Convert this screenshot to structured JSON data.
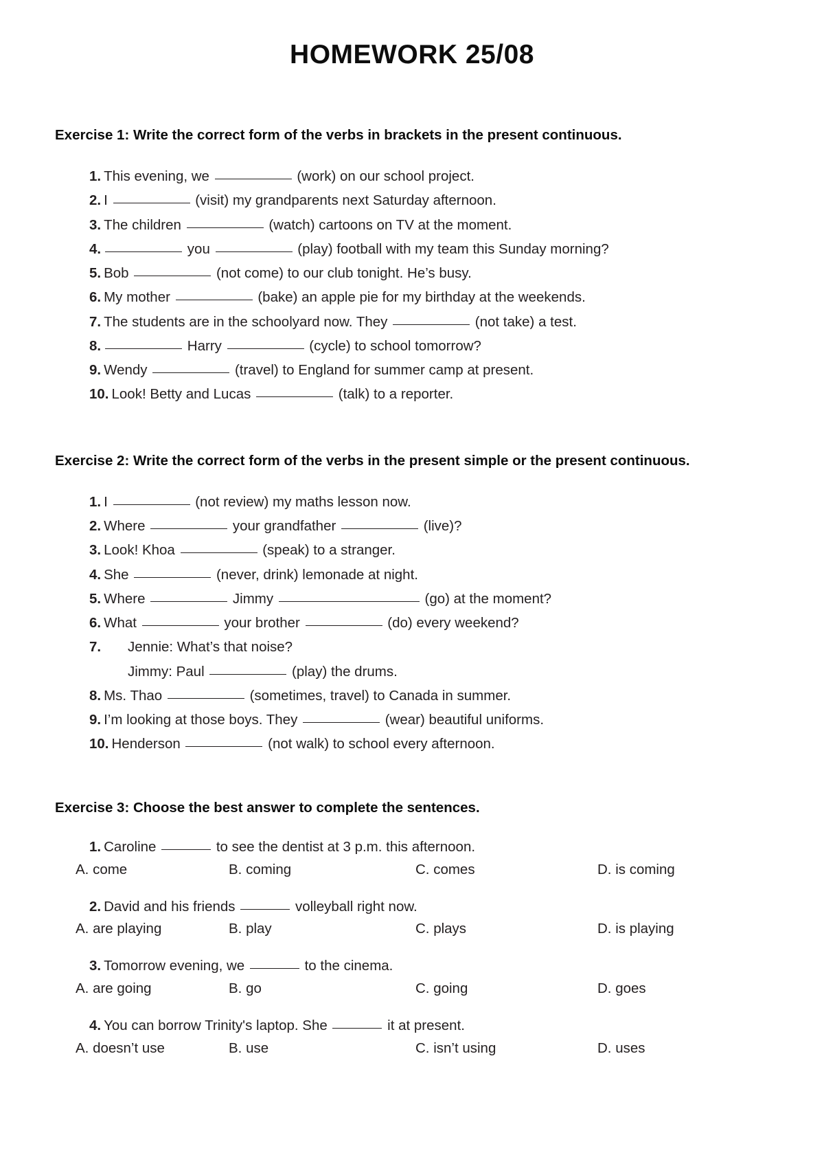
{
  "document": {
    "title": "HOMEWORK 25/08"
  },
  "exercise1": {
    "heading": "Exercise 1: Write the correct form of the verbs in brackets in the present continuous.",
    "items": [
      {
        "num": "1.",
        "parts": [
          {
            "t": "text",
            "v": "This evening, we "
          },
          {
            "t": "blank",
            "v": "md"
          },
          {
            "t": "text",
            "v": " (work) on our school project."
          }
        ]
      },
      {
        "num": "2.",
        "parts": [
          {
            "t": "text",
            "v": "I "
          },
          {
            "t": "blank",
            "v": "md"
          },
          {
            "t": "text",
            "v": " (visit) my grandparents next Saturday afternoon."
          }
        ]
      },
      {
        "num": "3.",
        "parts": [
          {
            "t": "text",
            "v": "The children "
          },
          {
            "t": "blank",
            "v": "md"
          },
          {
            "t": "text",
            "v": " (watch) cartoons on TV at the moment."
          }
        ]
      },
      {
        "num": "4.",
        "parts": [
          {
            "t": "blank",
            "v": "md"
          },
          {
            "t": "text",
            "v": " you "
          },
          {
            "t": "blank",
            "v": "md"
          },
          {
            "t": "text",
            "v": " (play) football with my team this Sunday morning?"
          }
        ]
      },
      {
        "num": "5.",
        "parts": [
          {
            "t": "text",
            "v": "Bob "
          },
          {
            "t": "blank",
            "v": "md"
          },
          {
            "t": "text",
            "v": " (not come) to our club tonight. He’s busy."
          }
        ]
      },
      {
        "num": "6.",
        "parts": [
          {
            "t": "text",
            "v": "My mother "
          },
          {
            "t": "blank",
            "v": "md"
          },
          {
            "t": "text",
            "v": " (bake) an apple pie for my birthday at the weekends."
          }
        ]
      },
      {
        "num": "7.",
        "parts": [
          {
            "t": "text",
            "v": "The students are in the schoolyard now. They "
          },
          {
            "t": "blank",
            "v": "md"
          },
          {
            "t": "text",
            "v": " (not take) a test."
          }
        ]
      },
      {
        "num": "8.",
        "parts": [
          {
            "t": "blank",
            "v": "md"
          },
          {
            "t": "text",
            "v": " Harry "
          },
          {
            "t": "blank",
            "v": "md"
          },
          {
            "t": "text",
            "v": " (cycle) to school tomorrow?"
          }
        ]
      },
      {
        "num": "9.",
        "parts": [
          {
            "t": "text",
            "v": "Wendy "
          },
          {
            "t": "blank",
            "v": "md"
          },
          {
            "t": "text",
            "v": " (travel) to England for summer camp at present."
          }
        ]
      },
      {
        "num": "10.",
        "parts": [
          {
            "t": "text",
            "v": "Look! Betty and Lucas "
          },
          {
            "t": "blank",
            "v": "md"
          },
          {
            "t": "text",
            "v": " (talk) to a reporter."
          }
        ]
      }
    ]
  },
  "exercise2": {
    "heading": "Exercise 2: Write the correct form of the verbs in the present simple or the present continuous.",
    "items": [
      {
        "num": "1.",
        "parts": [
          {
            "t": "text",
            "v": "I "
          },
          {
            "t": "blank",
            "v": "md"
          },
          {
            "t": "text",
            "v": " (not review) my maths lesson now."
          }
        ]
      },
      {
        "num": "2.",
        "parts": [
          {
            "t": "text",
            "v": "Where "
          },
          {
            "t": "blank",
            "v": "md"
          },
          {
            "t": "text",
            "v": " your grandfather "
          },
          {
            "t": "blank",
            "v": "md"
          },
          {
            "t": "text",
            "v": " (live)?"
          }
        ]
      },
      {
        "num": "3.",
        "parts": [
          {
            "t": "text",
            "v": "Look! Khoa "
          },
          {
            "t": "blank",
            "v": "md"
          },
          {
            "t": "text",
            "v": " (speak) to a stranger."
          }
        ]
      },
      {
        "num": "4.",
        "parts": [
          {
            "t": "text",
            "v": "She "
          },
          {
            "t": "blank",
            "v": "md"
          },
          {
            "t": "text",
            "v": " (never, drink) lemonade at night."
          }
        ]
      },
      {
        "num": "5.",
        "parts": [
          {
            "t": "text",
            "v": "Where "
          },
          {
            "t": "blank",
            "v": "md"
          },
          {
            "t": "text",
            "v": " Jimmy "
          },
          {
            "t": "blank",
            "v": "lg"
          },
          {
            "t": "text",
            "v": " (go) at the moment?"
          }
        ]
      },
      {
        "num": "6.",
        "parts": [
          {
            "t": "text",
            "v": "What "
          },
          {
            "t": "blank",
            "v": "md"
          },
          {
            "t": "text",
            "v": " your brother "
          },
          {
            "t": "blank",
            "v": "md"
          },
          {
            "t": "text",
            "v": " (do) every weekend?"
          }
        ]
      },
      {
        "num": "8.",
        "parts": [
          {
            "t": "text",
            "v": "Ms. Thao "
          },
          {
            "t": "blank",
            "v": "md"
          },
          {
            "t": "text",
            "v": " (sometimes, travel) to Canada in summer."
          }
        ]
      },
      {
        "num": "9.",
        "parts": [
          {
            "t": "text",
            "v": "I’m looking at those boys. They "
          },
          {
            "t": "blank",
            "v": "md"
          },
          {
            "t": "text",
            "v": " (wear) beautiful uniforms."
          }
        ]
      },
      {
        "num": "10.",
        "parts": [
          {
            "t": "text",
            "v": "Henderson "
          },
          {
            "t": "blank",
            "v": "md"
          },
          {
            "t": "text",
            "v": " (not walk) to school every afternoon."
          }
        ]
      }
    ],
    "dialogue_item": {
      "num": "7.",
      "line1": "Jennie: What’s that noise?",
      "line2_parts": [
        {
          "t": "text",
          "v": "Jimmy: Paul "
        },
        {
          "t": "blank",
          "v": "md"
        },
        {
          "t": "text",
          "v": " (play) the drums."
        }
      ]
    }
  },
  "exercise3": {
    "heading": "Exercise 3: Choose the best answer to complete the sentences.",
    "questions": [
      {
        "num": "1.",
        "stem_before": "Caroline ",
        "stem_after": " to see the dentist at 3 p.m. this afternoon.",
        "options": [
          "A. come",
          "B. coming",
          "C. comes",
          "D. is coming"
        ]
      },
      {
        "num": "2.",
        "stem_before": "David and his friends ",
        "stem_after": " volleyball right now.",
        "options": [
          "A. are playing",
          "B. play",
          "C. plays",
          "D. is playing"
        ]
      },
      {
        "num": "3.",
        "stem_before": "Tomorrow evening, we ",
        "stem_after": " to the cinema.",
        "options": [
          "A. are going",
          "B. go",
          "C. going",
          "D. goes"
        ]
      },
      {
        "num": "4.",
        "stem_before": "You can borrow Trinity's laptop. She ",
        "stem_after": " it at present.",
        "options": [
          "A. doesn’t use",
          "B. use",
          "C. isn’t using",
          "D. uses"
        ]
      }
    ]
  }
}
